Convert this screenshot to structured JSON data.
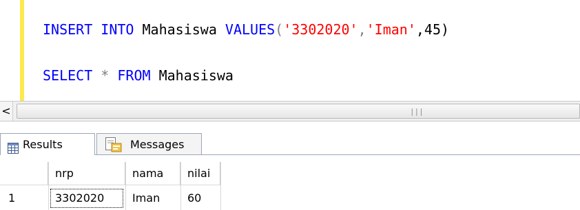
{
  "editor": {
    "line1": [
      {
        "text": "INSERT",
        "kind": "kw"
      },
      {
        "text": " ",
        "kind": "ident"
      },
      {
        "text": "INTO",
        "kind": "kw"
      },
      {
        "text": " Mahasiswa ",
        "kind": "ident"
      },
      {
        "text": "VALUES",
        "kind": "kw"
      },
      {
        "text": "(",
        "kind": "op"
      },
      {
        "text": "'3302020'",
        "kind": "str"
      },
      {
        "text": ",",
        "kind": "op"
      },
      {
        "text": "'Iman'",
        "kind": "str"
      },
      {
        "text": ",45)",
        "kind": "ident"
      }
    ],
    "line2": [
      {
        "text": "SELECT",
        "kind": "kw"
      },
      {
        "text": " ",
        "kind": "ident"
      },
      {
        "text": "*",
        "kind": "op"
      },
      {
        "text": " ",
        "kind": "ident"
      },
      {
        "text": "FROM",
        "kind": "kw"
      },
      {
        "text": " Mahasiswa",
        "kind": "ident"
      }
    ]
  },
  "scrollbar": {
    "left_arrow": "<",
    "grip": "|||"
  },
  "tabs": {
    "results_label": "Results",
    "messages_label": "Messages",
    "results_icon": "grid-icon",
    "messages_icon": "messages-icon"
  },
  "results": {
    "columns": [
      "nrp",
      "nama",
      "nilai"
    ],
    "rows": [
      {
        "rownum": "1",
        "nrp": "3302020",
        "nama": "Iman",
        "nilai": "60"
      }
    ]
  },
  "colors": {
    "keyword": "#0000ff",
    "string": "#ff0000",
    "operator": "#808080",
    "change_bar": "#ffe84d"
  }
}
